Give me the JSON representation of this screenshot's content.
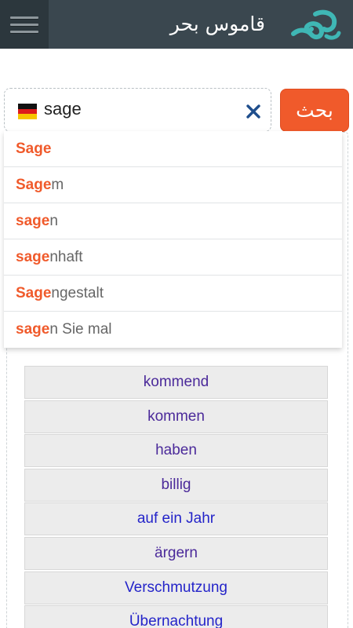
{
  "header": {
    "title": "قاموس بحر",
    "logo_icon": "bahr-wave-logo-icon",
    "menu_icon": "hamburger-menu-icon"
  },
  "search": {
    "value": "sage",
    "language_flag": "germany-flag-icon",
    "clear_icon": "close-x-icon",
    "button_label": "بحث"
  },
  "suggestions": [
    {
      "match": "Sage",
      "rest": ""
    },
    {
      "match": "Sage",
      "rest": "m"
    },
    {
      "match": "sage",
      "rest": "n"
    },
    {
      "match": "sage",
      "rest": "nhaft"
    },
    {
      "match": "Sage",
      "rest": "ngestalt"
    },
    {
      "match": "sage",
      "rest": "n Sie mal"
    }
  ],
  "words": [
    {
      "label": "kommend"
    },
    {
      "label": "kommen"
    },
    {
      "label": "haben"
    },
    {
      "label": "billig"
    },
    {
      "label": "auf ein Jahr"
    },
    {
      "label": "ärgern"
    },
    {
      "label": "Verschmutzung"
    },
    {
      "label": "Übernachtung"
    }
  ],
  "colors": {
    "header_bg": "#3a474f",
    "accent": "#f05a2b",
    "link_visited": "#4b2a9a",
    "link": "#2424c9"
  }
}
